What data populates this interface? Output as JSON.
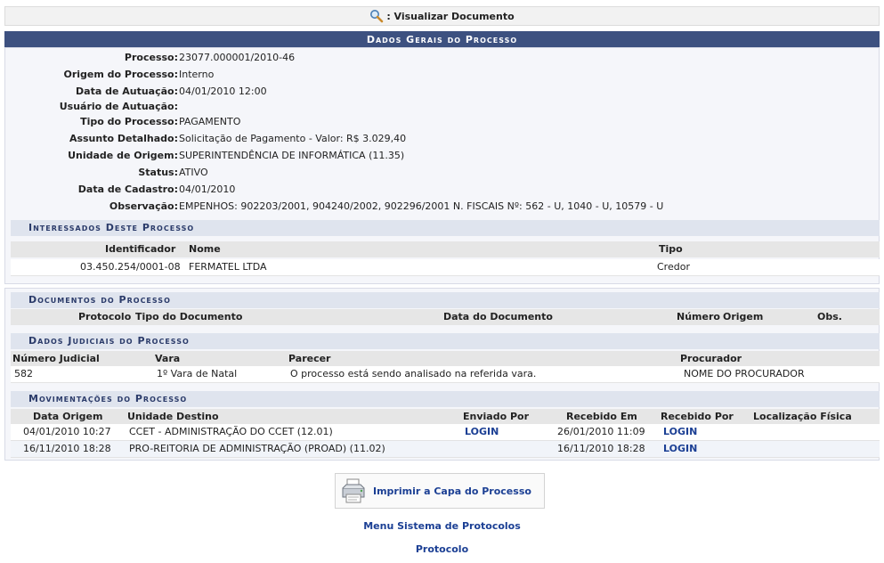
{
  "toolbar": {
    "view_document": ": Visualizar Documento"
  },
  "section_title": "Dados Gerais do Processo",
  "fields": [
    {
      "label": "Processo:",
      "value": "23077.000001/2010-46"
    },
    {
      "label": "Origem do Processo:",
      "value": "Interno"
    },
    {
      "label": "Data de Autuação:",
      "value": "04/01/2010 12:00"
    },
    {
      "label": "Usuário de Autuação:",
      "value": ""
    },
    {
      "label": "Tipo do Processo:",
      "value": "PAGAMENTO"
    },
    {
      "label": "Assunto Detalhado:",
      "value": "Solicitação de Pagamento - Valor: R$ 3.029,40"
    },
    {
      "label": "Unidade de Origem:",
      "value": "SUPERINTENDÊNCIA DE INFORMÁTICA (11.35)"
    },
    {
      "label": "Status:",
      "value": "ATIVO"
    },
    {
      "label": "Data de Cadastro:",
      "value": "04/01/2010"
    },
    {
      "label": "Observação:",
      "value": "EMPENHOS: 902203/2001, 904240/2002, 902296/2001 N. FISCAIS Nº: 562 - U, 1040 - U, 10579 - U"
    }
  ],
  "interessados": {
    "title": "Interessados Deste Processo",
    "headers": [
      "Identificador",
      "Nome",
      "Tipo"
    ],
    "rows": [
      [
        "03.450.254/0001-08",
        "FERMATEL LTDA",
        "Credor"
      ]
    ]
  },
  "documentos": {
    "title": "Documentos do Processo",
    "headers": [
      "Protocolo",
      "Tipo do Documento",
      "Data do Documento",
      "Número",
      "Origem",
      "Obs."
    ]
  },
  "judiciais": {
    "title": "Dados Judiciais do Processo",
    "headers": [
      "Número Judicial",
      "Vara",
      "Parecer",
      "Procurador"
    ],
    "rows": [
      [
        "582",
        "1º Vara de Natal",
        "O processo está sendo analisado na referida vara.",
        "NOME DO PROCURADOR"
      ]
    ]
  },
  "movimentacoes": {
    "title": "Movimentações do Processo",
    "headers": [
      "Data Origem",
      "Unidade Destino",
      "Enviado Por",
      "Recebido Em",
      "Recebido Por",
      "Localização Física"
    ],
    "rows": [
      [
        "04/01/2010 10:27",
        "CCET - ADMINISTRAÇÃO DO CCET (12.01)",
        "LOGIN",
        "26/01/2010 11:09",
        "LOGIN",
        ""
      ],
      [
        "16/11/2010 18:28",
        "PRO-REITORIA DE ADMINISTRAÇÃO (PROAD) (11.02)",
        "",
        "16/11/2010 18:28",
        "LOGIN",
        ""
      ]
    ]
  },
  "actions": {
    "print_cover": "Imprimir a Capa do Processo",
    "menu_link": "Menu Sistema de Protocolos",
    "protocolo_link": "Protocolo"
  },
  "colors": {
    "header_bg": "#3d5180",
    "link": "#1b3f94",
    "subheader_bg": "#dfe4ee"
  },
  "icons": [
    "magnifier-icon",
    "printer-icon"
  ]
}
